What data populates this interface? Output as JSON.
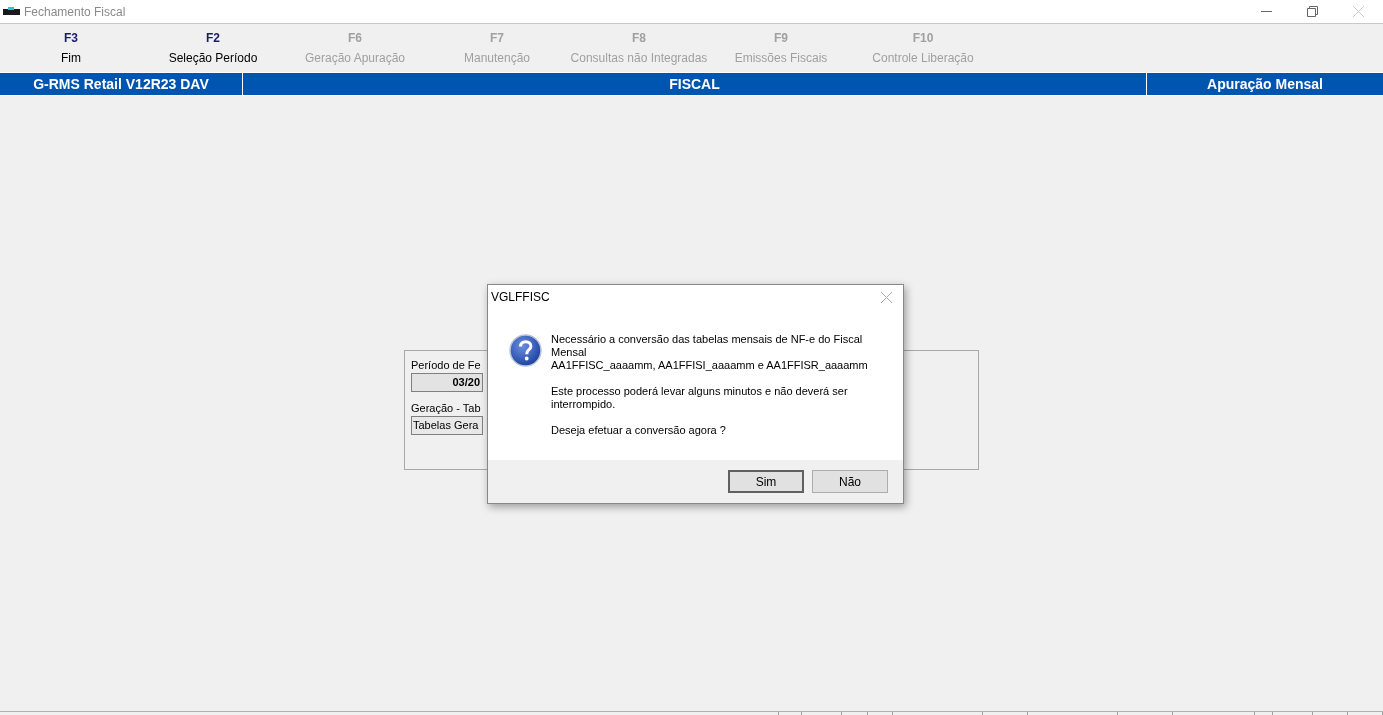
{
  "window": {
    "title": "Fechamento Fiscal"
  },
  "toolbar": [
    {
      "key": "F3",
      "label": "Fim",
      "disabled": false
    },
    {
      "key": "F2",
      "label": "Seleção Período",
      "disabled": false
    },
    {
      "key": "F6",
      "label": "Geração Apuração",
      "disabled": true
    },
    {
      "key": "F7",
      "label": "Manutenção",
      "disabled": true
    },
    {
      "key": "F8",
      "label": "Consultas não Integradas",
      "disabled": true
    },
    {
      "key": "F9",
      "label": "Emissões Fiscais",
      "disabled": true
    },
    {
      "key": "F10",
      "label": "Controle Liberação",
      "disabled": true
    }
  ],
  "header": {
    "system": "G-RMS Retail V12R23 DAV",
    "module": "FISCAL",
    "screen": "Apuração Mensal"
  },
  "panel": {
    "period_label": "Período de Fe",
    "period_value": "03/20",
    "generation_label": "Geração - Tab",
    "generation_value": "Tabelas Gera"
  },
  "dialog": {
    "title": "VGLFFISC",
    "paragraphs": [
      "Necessário a conversão das tabelas mensais de NF-e do Fiscal Mensal\nAA1FFISC_aaaamm, AA1FFISI_aaaamm e AA1FFISR_aaaamm",
      "Este processo poderá levar alguns minutos e não deverá ser interrompido.",
      "Deseja efetuar a conversão agora ?"
    ],
    "buttons": [
      {
        "label": "Sim",
        "default": true
      },
      {
        "label": "Não",
        "default": false
      }
    ]
  }
}
